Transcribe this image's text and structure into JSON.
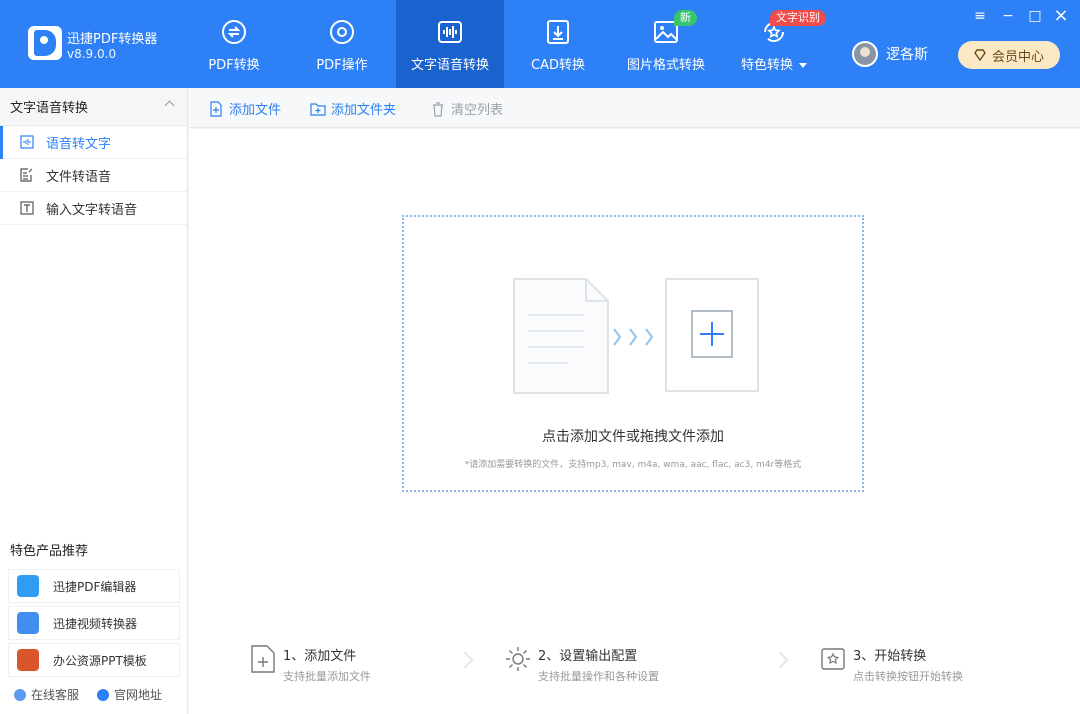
{
  "app": {
    "name": "迅捷PDF转换器",
    "version": "v8.9.0.0"
  },
  "nav": [
    {
      "label": "PDF转换",
      "icon": "pdf-convert-icon",
      "active": false,
      "badge": ""
    },
    {
      "label": "PDF操作",
      "icon": "pdf-operate-icon",
      "active": false,
      "badge": ""
    },
    {
      "label": "文字语音转换",
      "icon": "audio-wave-icon",
      "active": true,
      "badge": ""
    },
    {
      "label": "CAD转换",
      "icon": "cad-icon",
      "active": false,
      "badge": ""
    },
    {
      "label": "图片格式转换",
      "icon": "image-icon",
      "active": false,
      "badge": "新"
    },
    {
      "label": "特色转换",
      "icon": "star-refresh-icon",
      "active": false,
      "badge": "文字识别"
    }
  ],
  "user": {
    "name": "逻各斯",
    "vip_label": "会员中心"
  },
  "window_controls": {
    "menu": "≡",
    "minimize": "−",
    "maximize": "□",
    "close": "×"
  },
  "sidebar": {
    "section_title": "文字语音转换",
    "items": [
      {
        "label": "语音转文字",
        "icon": "audio-file-icon",
        "active": true
      },
      {
        "label": "文件转语音",
        "icon": "doc-edit-icon",
        "active": false
      },
      {
        "label": "输入文字转语音",
        "icon": "text-box-icon",
        "active": false
      }
    ],
    "recommend_title": "特色产品推荐",
    "recommend": [
      {
        "label": "迅捷PDF编辑器",
        "icon": "pdf-editor-app-icon"
      },
      {
        "label": "迅捷视频转换器",
        "icon": "video-converter-app-icon"
      },
      {
        "label": "办公资源PPT模板",
        "icon": "ppt-template-app-icon"
      }
    ],
    "footer": {
      "service": "在线客服",
      "website": "官网地址"
    }
  },
  "toolbar": {
    "add_file": "添加文件",
    "add_folder": "添加文件夹",
    "clear_list": "清空列表"
  },
  "dropzone": {
    "title": "点击添加文件或拖拽文件添加",
    "hint": "*请添加需要转换的文件，支持mp3, mav, m4a, wma, aac, flac, ac3, m4r等格式"
  },
  "steps": [
    {
      "title": "1、添加文件",
      "sub": "支持批量添加文件",
      "icon": "add-file-icon"
    },
    {
      "title": "2、设置输出配置",
      "sub": "支持批量操作和各种设置",
      "icon": "settings-gear-icon"
    },
    {
      "title": "3、开始转换",
      "sub": "点击转换按钮开始转换",
      "icon": "start-convert-icon"
    }
  ],
  "colors": {
    "primary": "#2d80f5",
    "active_nav": "#1a63cf",
    "vip_bg": "#fbe9c5",
    "badge_green": "#3bc46f",
    "badge_red": "#f14b4b"
  }
}
